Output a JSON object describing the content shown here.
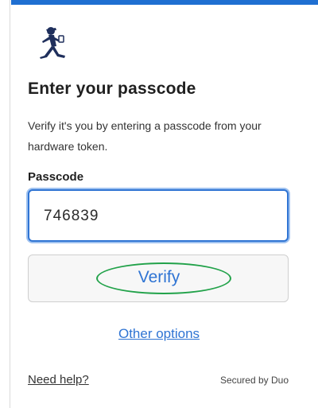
{
  "logo": {
    "icon": "running-figure-logo-icon"
  },
  "heading": "Enter your passcode",
  "description": "Verify it's you by entering a passcode from your hardware token.",
  "passcode": {
    "label": "Passcode",
    "value": "746839"
  },
  "verify_button": "Verify",
  "other_options": "Other options",
  "help_link": "Need help?",
  "footer_secured": "Secured by Duo",
  "colors": {
    "accent": "#2f74d3",
    "topbar": "#1f6fd1",
    "annotation_ring": "#22a24a"
  }
}
